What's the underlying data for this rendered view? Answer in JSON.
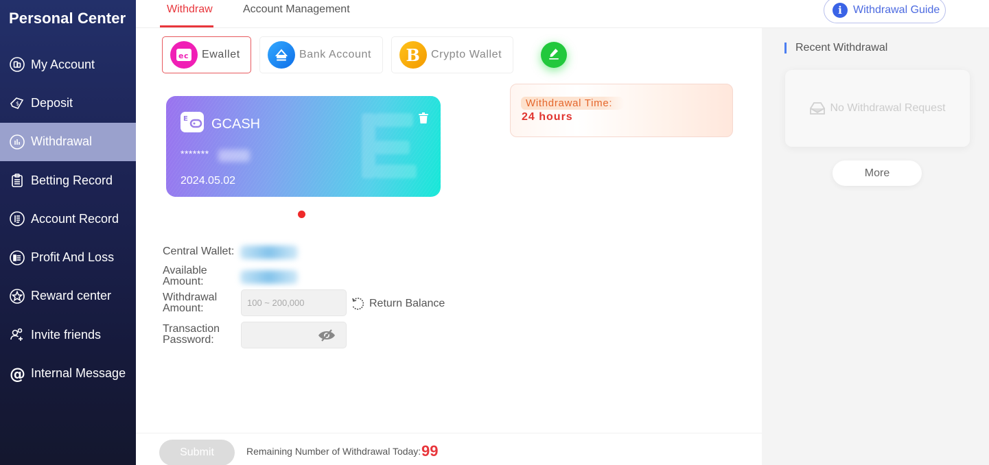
{
  "sidebar": {
    "title": "Personal Center",
    "items": [
      {
        "label": "My Account",
        "icon": "account-icon"
      },
      {
        "label": "Deposit",
        "icon": "deposit-icon"
      },
      {
        "label": "Withdrawal",
        "icon": "withdrawal-icon",
        "active": true
      },
      {
        "label": "Betting Record",
        "icon": "clipboard-icon"
      },
      {
        "label": "Account Record",
        "icon": "record-icon"
      },
      {
        "label": "Profit And Loss",
        "icon": "list-icon"
      },
      {
        "label": "Reward center",
        "icon": "star-icon"
      },
      {
        "label": "Invite friends",
        "icon": "invite-icon"
      },
      {
        "label": "Internal Message",
        "icon": "at-icon"
      }
    ]
  },
  "tabs": [
    {
      "label": "Withdraw",
      "active": true
    },
    {
      "label": "Account Management",
      "active": false
    }
  ],
  "guide_button": "Withdrawal Guide",
  "methods": [
    {
      "label": "Ewallet",
      "active": true,
      "color": "#f01fb5"
    },
    {
      "label": "Bank Account",
      "active": false,
      "color": "#1a7ff0"
    },
    {
      "label": "Crypto Wallet",
      "active": false,
      "color": "#f6a700"
    }
  ],
  "withdrawal_time": {
    "label": "Withdrawal Time:",
    "value": "24 hours"
  },
  "card": {
    "name": "GCASH",
    "number_masked": "*******",
    "date": "2024.05.02"
  },
  "form": {
    "central_wallet_label": "Central Wallet:",
    "available_amount_label_1": "Available",
    "available_amount_label_2": "Amount:",
    "withdrawal_amount_label_1": "Withdrawal",
    "withdrawal_amount_label_2": "Amount:",
    "withdrawal_amount_placeholder": "100 ~ 200,000",
    "return_balance": "Return Balance",
    "password_label_1": "Transaction",
    "password_label_2": "Password:"
  },
  "footer": {
    "submit": "Submit",
    "remaining_label": "Remaining Number of Withdrawal Today:",
    "remaining_count": "99"
  },
  "recent": {
    "title": "Recent Withdrawal",
    "empty": "No Withdrawal Request",
    "more": "More"
  },
  "colors": {
    "accent_red": "#e8363c",
    "active_nav": "#9aa1cd",
    "guide_blue": "#4c6ae0"
  }
}
